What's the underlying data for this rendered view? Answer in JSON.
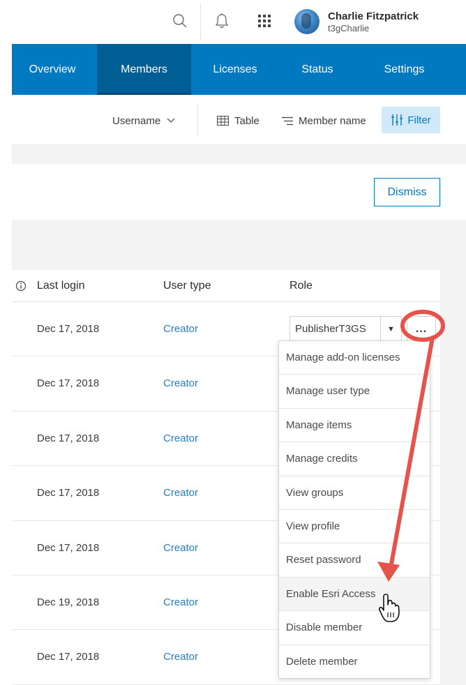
{
  "user": {
    "name": "Charlie Fitzpatrick",
    "handle": "t3gCharlie"
  },
  "header_icons": [
    "search-icon",
    "bell-icon",
    "apps-grid-icon"
  ],
  "nav": {
    "tabs": [
      {
        "label": "Overview",
        "active": false
      },
      {
        "label": "Members",
        "active": true
      },
      {
        "label": "Licenses",
        "active": false
      },
      {
        "label": "Status",
        "active": false
      },
      {
        "label": "Settings",
        "active": false
      }
    ]
  },
  "toolbar": {
    "sort_label": "Username",
    "view_label": "Table",
    "name_label": "Member name",
    "filter_label": "Filter"
  },
  "notice": {
    "dismiss_label": "Dismiss"
  },
  "table": {
    "headers": {
      "last_login": "Last login",
      "user_type": "User type",
      "role": "Role"
    },
    "rows": [
      {
        "last_login": "Dec 17, 2018",
        "user_type": "Creator"
      },
      {
        "last_login": "Dec 17, 2018",
        "user_type": "Creator"
      },
      {
        "last_login": "Dec 17, 2018",
        "user_type": "Creator"
      },
      {
        "last_login": "Dec 17, 2018",
        "user_type": "Creator"
      },
      {
        "last_login": "Dec 17, 2018",
        "user_type": "Creator"
      },
      {
        "last_login": "Dec 19, 2018",
        "user_type": "Creator"
      },
      {
        "last_login": "Dec 17, 2018",
        "user_type": "Creator"
      }
    ],
    "first_row_role": "PublisherT3GS",
    "more_label": "..."
  },
  "menu": {
    "items": [
      "Manage add-on licenses",
      "Manage user type",
      "Manage items",
      "Manage credits",
      "View groups",
      "View profile",
      "Reset password",
      "Enable Esri Access",
      "Disable member",
      "Delete member"
    ],
    "hover_index": 7
  },
  "colors": {
    "brand_blue": "#0079c1",
    "nav_active": "#005e95",
    "link": "#2b7bbf",
    "annotation_red": "#e5534b",
    "filter_bg": "#d2e9f9"
  }
}
